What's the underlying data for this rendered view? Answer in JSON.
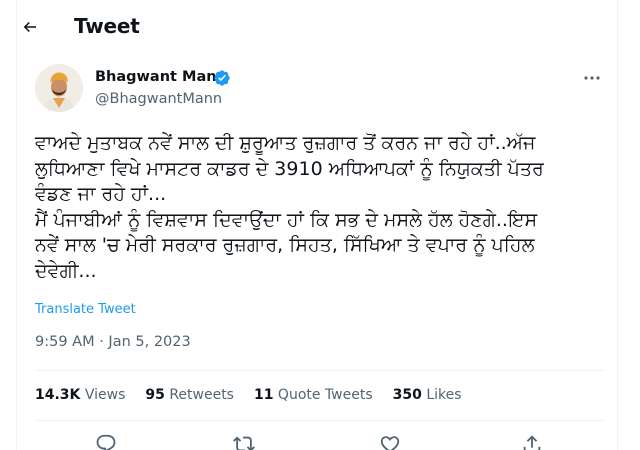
{
  "header": {
    "title": "Tweet",
    "back_icon": "back-arrow-icon"
  },
  "tweet": {
    "author_name": "Bhagwant Mann",
    "handle": "@BhagwantMann",
    "verified_icon": "verified-badge-icon",
    "more_icon": "more-options-icon",
    "text": "ਵਾਅਦੇ ਮੁਤਾਬਕ ਨਵੇਂ ਸਾਲ ਦੀ ਸ਼ੁਰੂਆਤ ਰੁਜ਼ਗਾਰ ਤੋਂ ਕਰਨ ਜਾ ਰਹੇ ਹਾਂ..ਅੱਜ\nਲੁਧਿਆਣਾ ਵਿਖੇ ਮਾਸਟਰ ਕਾਡਰ ਦੇ 3910 ਅਧਿਆਪਕਾਂ ਨੂੰ ਨਿਯੁਕਤੀ ਪੱਤਰ\nਵੰਡਣ ਜਾ ਰਹੇ ਹਾਂ...\nਮੈਂ ਪੰਜਾਬੀਆਂ ਨੂੰ ਵਿਸ਼ਵਾਸ ਦਿਵਾਉਂਦਾ ਹਾਂ ਕਿ ਸਭ ਦੇ ਮਸਲੇ ਹੱਲ ਹੋਣਗੇ..ਇਸ\nਨਵੇਂ ਸਾਲ 'ਚ ਮੇਰੀ ਸਰਕਾਰ ਰੁਜ਼ਗਾਰ, ਸਿਹਤ, ਸਿੱਖਿਆ ਤੇ ਵਪਾਰ ਨੂੰ ਪਹਿਲ\nਦੇਵੇਗੀ...",
    "translate_label": "Translate Tweet",
    "timestamp": "9:59 AM · Jan 5, 2023"
  },
  "stats": {
    "views_count": "14.3K",
    "views_label": "Views",
    "retweets_count": "95",
    "retweets_label": "Retweets",
    "quotes_count": "11",
    "quotes_label": "Quote Tweets",
    "likes_count": "350",
    "likes_label": "Likes"
  },
  "actions": {
    "reply_icon": "reply-icon",
    "retweet_icon": "retweet-icon",
    "like_icon": "like-icon",
    "share_icon": "share-icon"
  },
  "colors": {
    "accent": "#1d9bf0",
    "text_primary": "#0f1419",
    "text_secondary": "#536471",
    "divider": "#eff3f4"
  }
}
